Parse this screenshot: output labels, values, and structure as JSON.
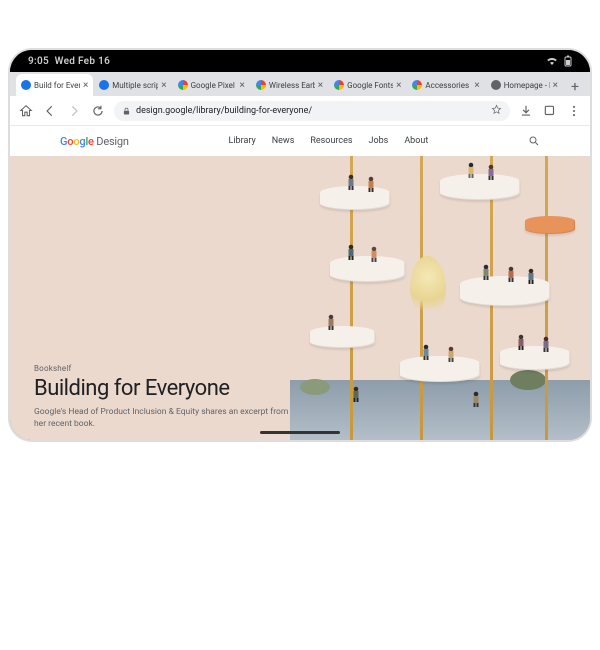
{
  "statusbar": {
    "time": "9:05",
    "date": "Wed Feb 16"
  },
  "tabs": [
    {
      "label": "Build for Everyo",
      "active": true,
      "favicon": "#1a73e8"
    },
    {
      "label": "Multiple scripts",
      "active": false,
      "favicon": "#1a73e8"
    },
    {
      "label": "Google Pixel Ho",
      "active": false,
      "favicon": "gmulti"
    },
    {
      "label": "Wireless Earbu",
      "active": false,
      "favicon": "gmulti"
    },
    {
      "label": "Google Fonts D",
      "active": false,
      "favicon": "gmulti"
    },
    {
      "label": "Accessories - G",
      "active": false,
      "favicon": "gmulti"
    },
    {
      "label": "Homepage - Mo",
      "active": false,
      "favicon": "#5f6368"
    }
  ],
  "omnibox": {
    "url": "design.google/library/building-for-everyone/"
  },
  "site": {
    "brand_plain": "Google",
    "brand_word2": "Design",
    "nav": [
      "Library",
      "News",
      "Resources",
      "Jobs",
      "About"
    ]
  },
  "hero": {
    "kicker": "Bookshelf",
    "title": "Building for Everyone",
    "sub": "Google's Head of Product Inclusion & Equity shares an excerpt from her recent book."
  }
}
